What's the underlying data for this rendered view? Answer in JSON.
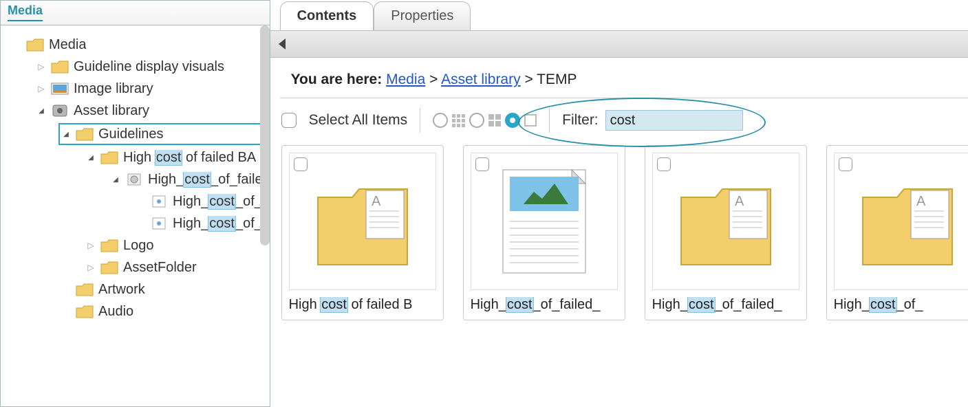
{
  "sidebar": {
    "title": "Media",
    "tree": {
      "root": {
        "label": "Media"
      },
      "guideline_visuals": {
        "label": "Guideline display visuals"
      },
      "image_library": {
        "label": "Image library"
      },
      "asset_library": {
        "label": "Asset library"
      },
      "guidelines": {
        "label": "Guidelines"
      },
      "high_cost_ba": {
        "pre": "High ",
        "hl": "cost",
        "post": " of failed BA"
      },
      "high_cost_faile": {
        "pre": "High_",
        "hl": "cost",
        "post": "_of_faile"
      },
      "high_cost_of_1": {
        "pre": "High_",
        "hl": "cost",
        "post": "_of_"
      },
      "high_cost_of_2": {
        "pre": "High_",
        "hl": "cost",
        "post": "_of_"
      },
      "logo": {
        "label": "Logo"
      },
      "assetfolder": {
        "label": "AssetFolder"
      },
      "artwork": {
        "label": "Artwork"
      },
      "audio": {
        "label": "Audio"
      }
    }
  },
  "tabs": {
    "contents": "Contents",
    "properties": "Properties"
  },
  "breadcrumb": {
    "prefix": "You are here: ",
    "media": "Media",
    "sep": " > ",
    "asset_library": "Asset library",
    "current": "TEMP"
  },
  "toolbar": {
    "select_all": "Select All Items",
    "filter_label": "Filter:",
    "filter_value": "cost"
  },
  "cards": [
    {
      "pre": "High ",
      "hl": "cost",
      "post": " of failed B",
      "type": "folder"
    },
    {
      "pre": "High_",
      "hl": "cost",
      "post": "_of_failed_",
      "type": "image"
    },
    {
      "pre": "High_",
      "hl": "cost",
      "post": "_of_failed_",
      "type": "folder"
    },
    {
      "pre": "High_",
      "hl": "cost",
      "post": "_of_",
      "type": "folder"
    }
  ]
}
